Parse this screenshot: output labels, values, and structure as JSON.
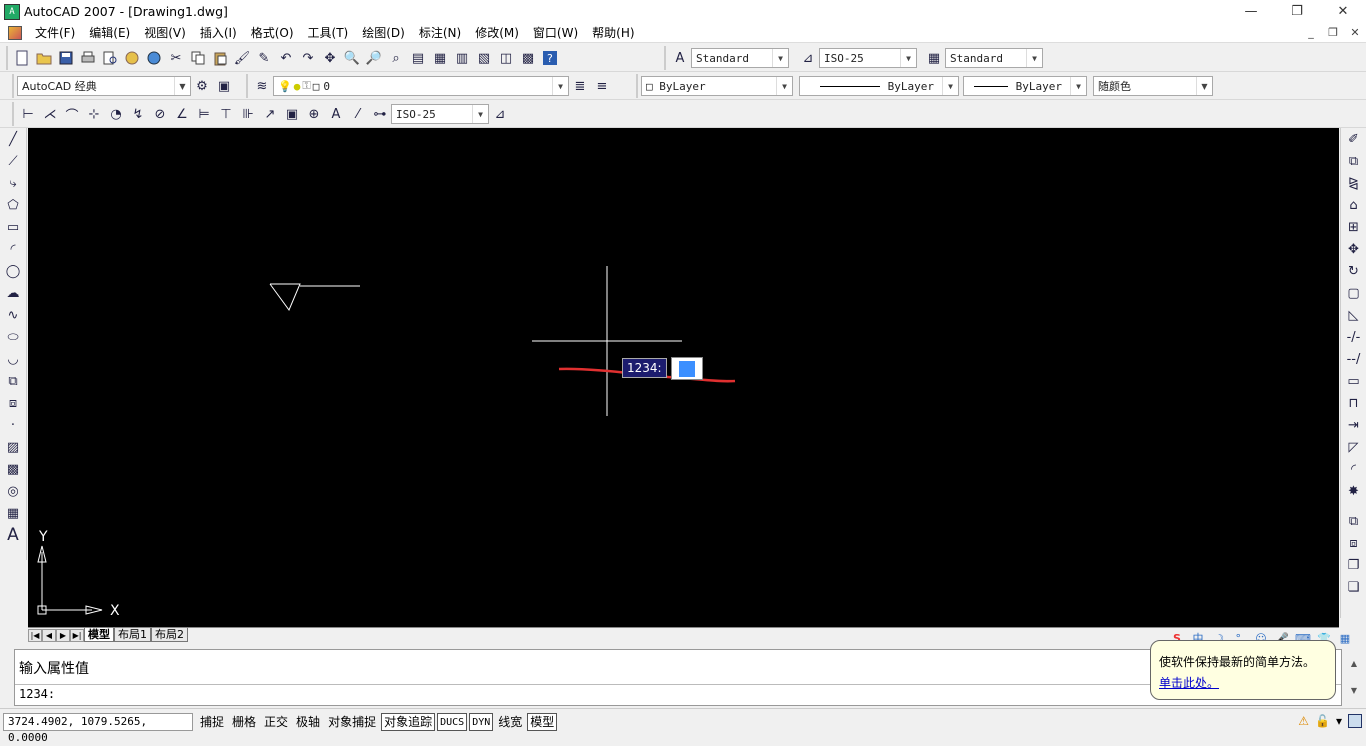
{
  "title": {
    "app_icon_text": "A",
    "text": "AutoCAD 2007 - [Drawing1.dwg]"
  },
  "window_controls": {
    "minimize": "—",
    "maximize": "❐",
    "close": "✕"
  },
  "mdi_controls": {
    "minimize": "_",
    "restore": "❐",
    "close": "✕"
  },
  "menu": {
    "items": [
      "文件(F)",
      "编辑(E)",
      "视图(V)",
      "插入(I)",
      "格式(O)",
      "工具(T)",
      "绘图(D)",
      "标注(N)",
      "修改(M)",
      "窗口(W)",
      "帮助(H)"
    ]
  },
  "toolbar1": {
    "text_style": "Standard",
    "dim_style": "ISO-25",
    "table_style": "Standard"
  },
  "toolbar2": {
    "workspace": "AutoCAD 经典",
    "layer": "0",
    "color": "ByLayer",
    "linetype": "ByLayer",
    "lineweight": "ByLayer",
    "plot_style": "随颜色"
  },
  "toolbar3": {
    "dim_style": "ISO-25"
  },
  "canvas": {
    "ucs_x_label": "X",
    "ucs_y_label": "Y",
    "dynamic_input_prompt": "1234:"
  },
  "layout_tabs": {
    "tabs": [
      "模型",
      "布局1",
      "布局2"
    ],
    "active": "模型"
  },
  "command": {
    "history": "输入属性值",
    "current": "1234:"
  },
  "balloon": {
    "text": "使软件保持最新的简单方法。",
    "link": "单击此处。"
  },
  "status": {
    "coordinates": "3724.4902, 1079.5265, 0.0000",
    "buttons": [
      {
        "label": "捕捉",
        "on": false
      },
      {
        "label": "栅格",
        "on": false
      },
      {
        "label": "正交",
        "on": false
      },
      {
        "label": "极轴",
        "on": false
      },
      {
        "label": "对象捕捉",
        "on": false
      },
      {
        "label": "对象追踪",
        "on": true
      },
      {
        "label": "DUCS",
        "on": true
      },
      {
        "label": "DYN",
        "on": true
      },
      {
        "label": "线宽",
        "on": false
      },
      {
        "label": "模型",
        "on": true
      }
    ]
  },
  "colors": {
    "canvas_bg": "#000000",
    "annotation_stroke": "#e03030",
    "dyn_input_bg": "#1c1c6e",
    "dyn_box_fill": "#3b8fff"
  }
}
